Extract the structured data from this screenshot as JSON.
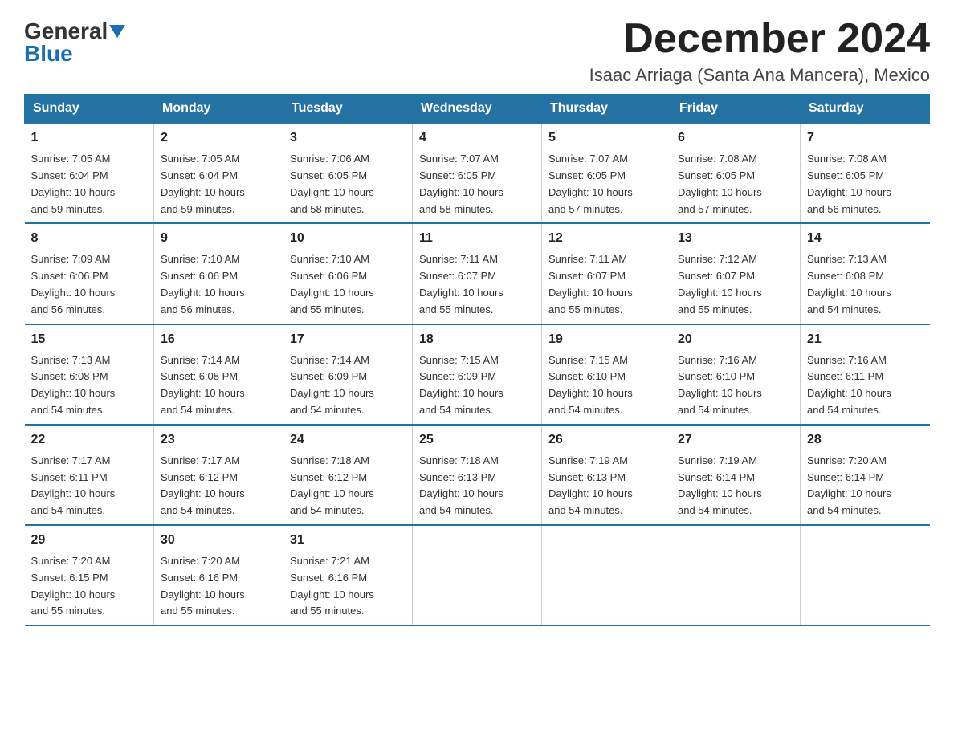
{
  "header": {
    "logo_general": "General",
    "logo_blue": "Blue",
    "month_title": "December 2024",
    "subtitle": "Isaac Arriaga (Santa Ana Mancera), Mexico"
  },
  "days_of_week": [
    "Sunday",
    "Monday",
    "Tuesday",
    "Wednesday",
    "Thursday",
    "Friday",
    "Saturday"
  ],
  "weeks": [
    [
      {
        "day": "1",
        "sunrise": "7:05 AM",
        "sunset": "6:04 PM",
        "daylight": "10 hours and 59 minutes."
      },
      {
        "day": "2",
        "sunrise": "7:05 AM",
        "sunset": "6:04 PM",
        "daylight": "10 hours and 59 minutes."
      },
      {
        "day": "3",
        "sunrise": "7:06 AM",
        "sunset": "6:05 PM",
        "daylight": "10 hours and 58 minutes."
      },
      {
        "day": "4",
        "sunrise": "7:07 AM",
        "sunset": "6:05 PM",
        "daylight": "10 hours and 58 minutes."
      },
      {
        "day": "5",
        "sunrise": "7:07 AM",
        "sunset": "6:05 PM",
        "daylight": "10 hours and 57 minutes."
      },
      {
        "day": "6",
        "sunrise": "7:08 AM",
        "sunset": "6:05 PM",
        "daylight": "10 hours and 57 minutes."
      },
      {
        "day": "7",
        "sunrise": "7:08 AM",
        "sunset": "6:05 PM",
        "daylight": "10 hours and 56 minutes."
      }
    ],
    [
      {
        "day": "8",
        "sunrise": "7:09 AM",
        "sunset": "6:06 PM",
        "daylight": "10 hours and 56 minutes."
      },
      {
        "day": "9",
        "sunrise": "7:10 AM",
        "sunset": "6:06 PM",
        "daylight": "10 hours and 56 minutes."
      },
      {
        "day": "10",
        "sunrise": "7:10 AM",
        "sunset": "6:06 PM",
        "daylight": "10 hours and 55 minutes."
      },
      {
        "day": "11",
        "sunrise": "7:11 AM",
        "sunset": "6:07 PM",
        "daylight": "10 hours and 55 minutes."
      },
      {
        "day": "12",
        "sunrise": "7:11 AM",
        "sunset": "6:07 PM",
        "daylight": "10 hours and 55 minutes."
      },
      {
        "day": "13",
        "sunrise": "7:12 AM",
        "sunset": "6:07 PM",
        "daylight": "10 hours and 55 minutes."
      },
      {
        "day": "14",
        "sunrise": "7:13 AM",
        "sunset": "6:08 PM",
        "daylight": "10 hours and 54 minutes."
      }
    ],
    [
      {
        "day": "15",
        "sunrise": "7:13 AM",
        "sunset": "6:08 PM",
        "daylight": "10 hours and 54 minutes."
      },
      {
        "day": "16",
        "sunrise": "7:14 AM",
        "sunset": "6:08 PM",
        "daylight": "10 hours and 54 minutes."
      },
      {
        "day": "17",
        "sunrise": "7:14 AM",
        "sunset": "6:09 PM",
        "daylight": "10 hours and 54 minutes."
      },
      {
        "day": "18",
        "sunrise": "7:15 AM",
        "sunset": "6:09 PM",
        "daylight": "10 hours and 54 minutes."
      },
      {
        "day": "19",
        "sunrise": "7:15 AM",
        "sunset": "6:10 PM",
        "daylight": "10 hours and 54 minutes."
      },
      {
        "day": "20",
        "sunrise": "7:16 AM",
        "sunset": "6:10 PM",
        "daylight": "10 hours and 54 minutes."
      },
      {
        "day": "21",
        "sunrise": "7:16 AM",
        "sunset": "6:11 PM",
        "daylight": "10 hours and 54 minutes."
      }
    ],
    [
      {
        "day": "22",
        "sunrise": "7:17 AM",
        "sunset": "6:11 PM",
        "daylight": "10 hours and 54 minutes."
      },
      {
        "day": "23",
        "sunrise": "7:17 AM",
        "sunset": "6:12 PM",
        "daylight": "10 hours and 54 minutes."
      },
      {
        "day": "24",
        "sunrise": "7:18 AM",
        "sunset": "6:12 PM",
        "daylight": "10 hours and 54 minutes."
      },
      {
        "day": "25",
        "sunrise": "7:18 AM",
        "sunset": "6:13 PM",
        "daylight": "10 hours and 54 minutes."
      },
      {
        "day": "26",
        "sunrise": "7:19 AM",
        "sunset": "6:13 PM",
        "daylight": "10 hours and 54 minutes."
      },
      {
        "day": "27",
        "sunrise": "7:19 AM",
        "sunset": "6:14 PM",
        "daylight": "10 hours and 54 minutes."
      },
      {
        "day": "28",
        "sunrise": "7:20 AM",
        "sunset": "6:14 PM",
        "daylight": "10 hours and 54 minutes."
      }
    ],
    [
      {
        "day": "29",
        "sunrise": "7:20 AM",
        "sunset": "6:15 PM",
        "daylight": "10 hours and 55 minutes."
      },
      {
        "day": "30",
        "sunrise": "7:20 AM",
        "sunset": "6:16 PM",
        "daylight": "10 hours and 55 minutes."
      },
      {
        "day": "31",
        "sunrise": "7:21 AM",
        "sunset": "6:16 PM",
        "daylight": "10 hours and 55 minutes."
      },
      null,
      null,
      null,
      null
    ]
  ],
  "labels": {
    "sunrise": "Sunrise:",
    "sunset": "Sunset:",
    "daylight": "Daylight:"
  }
}
